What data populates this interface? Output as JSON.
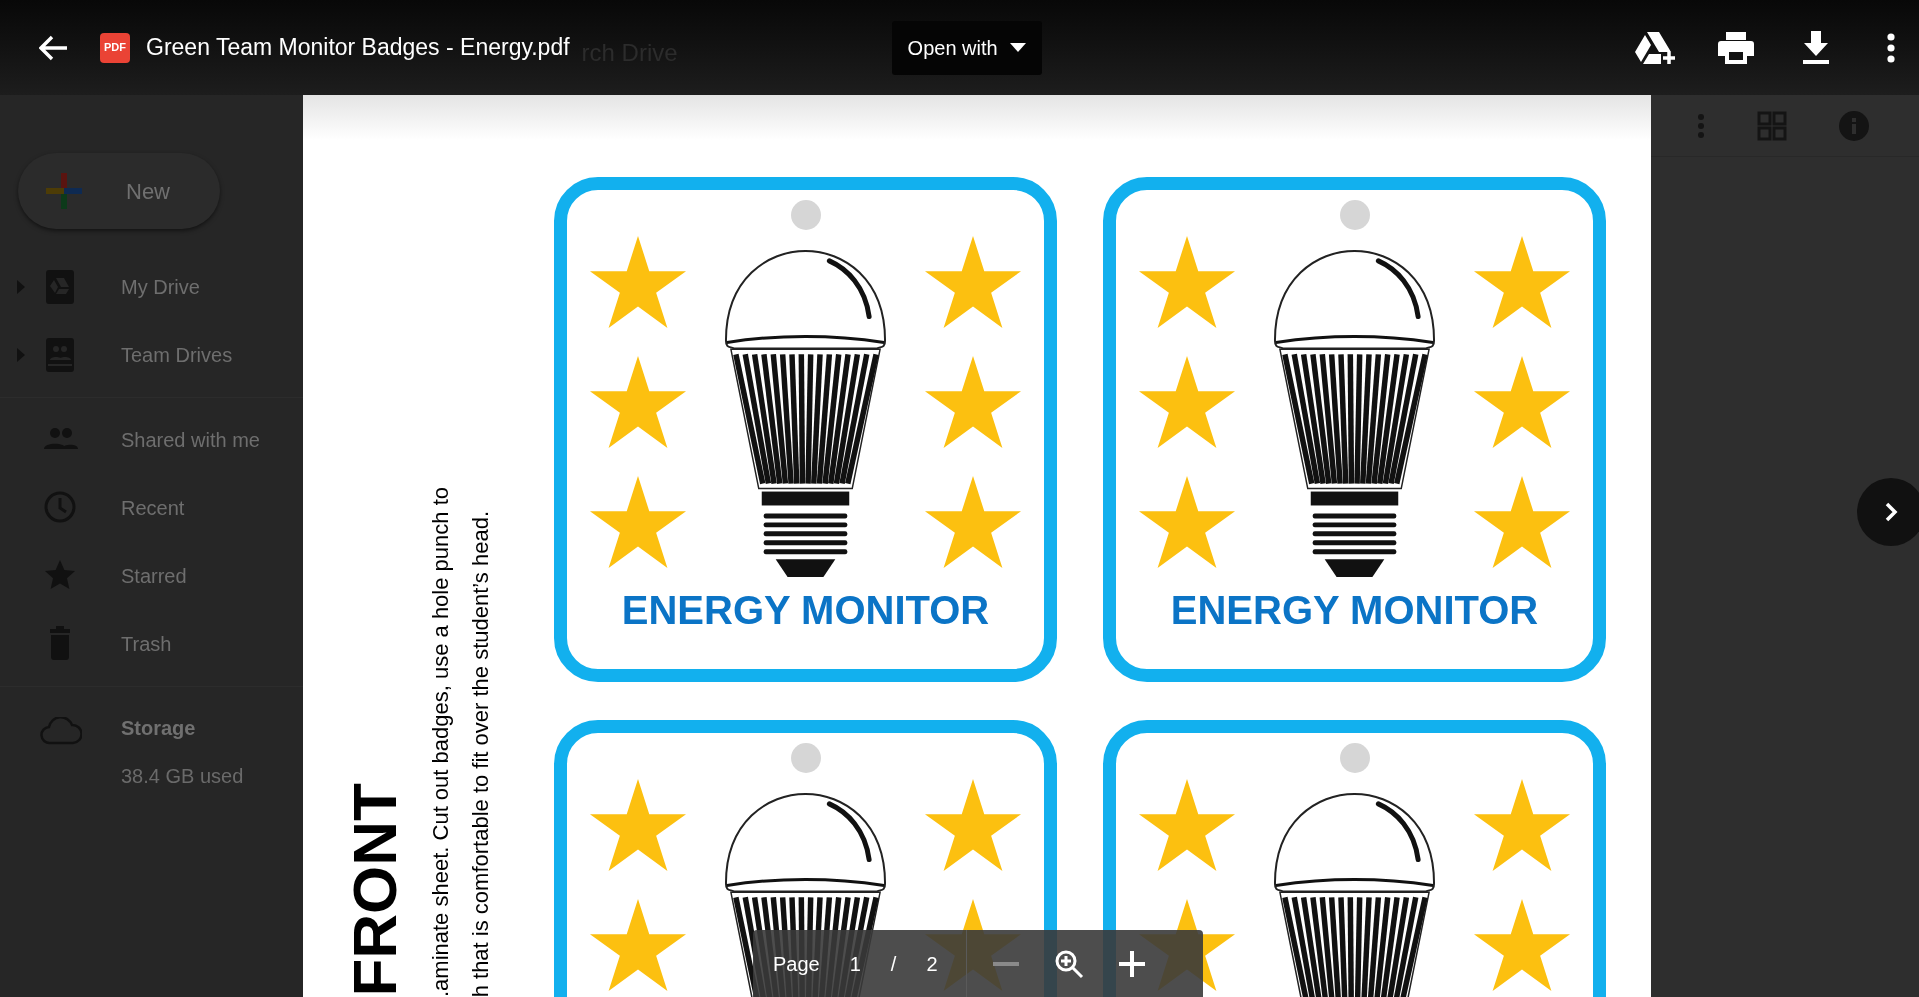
{
  "header": {
    "file_badge": "PDF",
    "title": "Green Team Monitor Badges - Energy.pdf",
    "background_text": "rch Drive",
    "open_with": "Open with"
  },
  "sidebar": {
    "new_button": "New",
    "sections": [
      {
        "items": [
          {
            "label": "My Drive",
            "kind": "my-drive",
            "expandable": true
          },
          {
            "label": "Team Drives",
            "kind": "team-drives",
            "expandable": true
          }
        ]
      },
      {
        "items": [
          {
            "label": "Shared with me",
            "kind": "shared",
            "expandable": false
          },
          {
            "label": "Recent",
            "kind": "recent",
            "expandable": false
          },
          {
            "label": "Starred",
            "kind": "starred",
            "expandable": false
          },
          {
            "label": "Trash",
            "kind": "trash",
            "expandable": false
          }
        ]
      }
    ],
    "storage": {
      "label": "Storage",
      "usage": "38.4 GB used"
    }
  },
  "document": {
    "heading": "FRONT",
    "instructions": [
      ".aminate sheet. Cut out badges, use a hole punch to",
      "h that is comfortable to fit over the student’s head."
    ],
    "badges": [
      {
        "kind": "lightbulb",
        "title": "ENERGY MONITOR"
      },
      {
        "kind": "lightbulb",
        "title": "ENERGY MONITOR"
      },
      {
        "kind": "lightbulb"
      },
      {
        "kind": "lightbulb"
      }
    ]
  },
  "page_controls": {
    "label": "Page",
    "current": "1",
    "separator": "/",
    "total": "2",
    "zoom_out": {
      "disabled": true
    },
    "zoom_in": {
      "disabled": false
    }
  }
}
